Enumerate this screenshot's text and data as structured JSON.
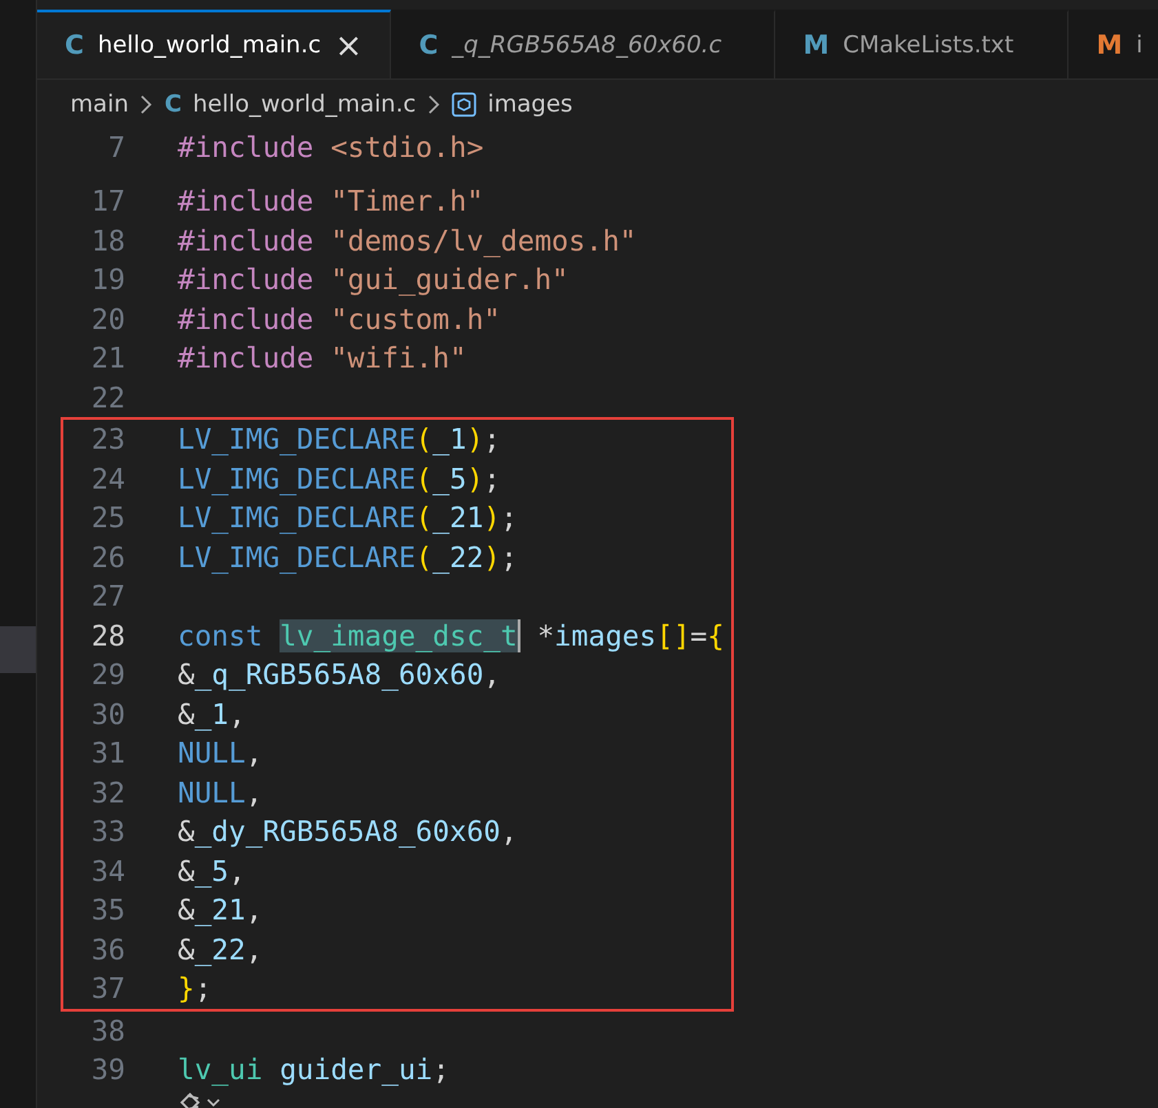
{
  "tabs": [
    {
      "icon": "C",
      "color": "#519aba",
      "label": "hello_world_main.c",
      "selected": true,
      "preview": false,
      "close": "×"
    },
    {
      "icon": "C",
      "color": "#519aba",
      "label": "_q_RGB565A8_60x60.c",
      "selected": false,
      "preview": true
    },
    {
      "icon": "M",
      "color": "#519aba",
      "label": "CMakeLists.txt",
      "selected": false,
      "preview": false
    },
    {
      "icon": "M",
      "color": "#e37933",
      "label": "i",
      "selected": false,
      "preview": false
    }
  ],
  "breadcrumb": [
    {
      "kind": "folder",
      "label": "main"
    },
    {
      "kind": "file",
      "icon": "C",
      "label": "hello_world_main.c"
    },
    {
      "kind": "symbol",
      "label": "images"
    }
  ],
  "sticky_line": {
    "number": "7",
    "tokens": [
      {
        "text": "#include ",
        "kind": "directive"
      },
      {
        "text": "<stdio.h>",
        "kind": "string"
      }
    ]
  },
  "lines_before": [
    {
      "number": "17",
      "current": false,
      "tokens": [
        {
          "text": "#include ",
          "kind": "directive"
        },
        {
          "text": "\"Timer.h\"",
          "kind": "string"
        }
      ]
    },
    {
      "number": "18",
      "current": false,
      "tokens": [
        {
          "text": "#include ",
          "kind": "directive"
        },
        {
          "text": "\"demos/lv_demos.h\"",
          "kind": "string"
        }
      ]
    },
    {
      "number": "19",
      "current": false,
      "tokens": [
        {
          "text": "#include ",
          "kind": "directive"
        },
        {
          "text": "\"gui_guider.h\"",
          "kind": "string"
        }
      ]
    },
    {
      "number": "20",
      "current": false,
      "tokens": [
        {
          "text": "#include ",
          "kind": "directive"
        },
        {
          "text": "\"custom.h\"",
          "kind": "string"
        }
      ]
    },
    {
      "number": "21",
      "current": false,
      "tokens": [
        {
          "text": "#include ",
          "kind": "directive"
        },
        {
          "text": "\"wifi.h\"",
          "kind": "string"
        }
      ]
    },
    {
      "number": "22",
      "current": false
    }
  ],
  "boxed_lines": [
    {
      "number": "23",
      "current": false,
      "tokens": [
        {
          "text": "LV_IMG_DECLARE",
          "kind": "macro"
        },
        {
          "text": "(",
          "kind": "bracket"
        },
        {
          "text": "_1",
          "kind": "var"
        },
        {
          "text": ")",
          "kind": "bracket"
        },
        {
          "text": ";",
          "kind": "punct"
        }
      ]
    },
    {
      "number": "24",
      "current": false,
      "tokens": [
        {
          "text": "LV_IMG_DECLARE",
          "kind": "macro"
        },
        {
          "text": "(",
          "kind": "bracket"
        },
        {
          "text": "_5",
          "kind": "var"
        },
        {
          "text": ")",
          "kind": "bracket"
        },
        {
          "text": ";",
          "kind": "punct"
        }
      ]
    },
    {
      "number": "25",
      "current": false,
      "tokens": [
        {
          "text": "LV_IMG_DECLARE",
          "kind": "macro"
        },
        {
          "text": "(",
          "kind": "bracket"
        },
        {
          "text": "_21",
          "kind": "var"
        },
        {
          "text": ")",
          "kind": "bracket"
        },
        {
          "text": ";",
          "kind": "punct"
        }
      ]
    },
    {
      "number": "26",
      "current": false,
      "tokens": [
        {
          "text": "LV_IMG_DECLARE",
          "kind": "macro"
        },
        {
          "text": "(",
          "kind": "bracket"
        },
        {
          "text": "_22",
          "kind": "var"
        },
        {
          "text": ")",
          "kind": "bracket"
        },
        {
          "text": ";",
          "kind": "punct"
        }
      ]
    },
    {
      "number": "27",
      "current": false
    },
    {
      "number": "28",
      "current": true,
      "tokens": [
        {
          "text": "const ",
          "kind": "keyword",
          "highlighted": false
        },
        {
          "text": "lv_image_dsc_t",
          "kind": "type",
          "highlighted": true
        },
        {
          "text": " *",
          "kind": "punct",
          "highlighted": false
        },
        {
          "text": "images",
          "kind": "var",
          "highlighted": false
        },
        {
          "text": "[]",
          "kind": "bracket",
          "highlighted": false
        },
        {
          "text": "=",
          "kind": "punct",
          "highlighted": false
        },
        {
          "text": "{",
          "kind": "bracket",
          "highlighted": false
        }
      ]
    },
    {
      "number": "29",
      "current": false,
      "tokens": [
        {
          "text": "&",
          "kind": "punct"
        },
        {
          "text": "_q_RGB565A8_60x60",
          "kind": "var"
        },
        {
          "text": ",",
          "kind": "punct"
        }
      ]
    },
    {
      "number": "30",
      "current": false,
      "tokens": [
        {
          "text": "&",
          "kind": "punct"
        },
        {
          "text": "_1",
          "kind": "var"
        },
        {
          "text": ",",
          "kind": "punct"
        }
      ]
    },
    {
      "number": "31",
      "current": false,
      "tokens": [
        {
          "text": "NULL",
          "kind": "keyword"
        },
        {
          "text": ",",
          "kind": "punct"
        }
      ]
    },
    {
      "number": "32",
      "current": false,
      "tokens": [
        {
          "text": "NULL",
          "kind": "keyword"
        },
        {
          "text": ",",
          "kind": "punct"
        }
      ]
    },
    {
      "number": "33",
      "current": false,
      "tokens": [
        {
          "text": "&",
          "kind": "punct"
        },
        {
          "text": "_dy_RGB565A8_60x60",
          "kind": "var"
        },
        {
          "text": ",",
          "kind": "punct"
        }
      ]
    },
    {
      "number": "34",
      "current": false,
      "tokens": [
        {
          "text": "&",
          "kind": "punct"
        },
        {
          "text": "_5",
          "kind": "var"
        },
        {
          "text": ",",
          "kind": "punct"
        }
      ]
    },
    {
      "number": "35",
      "current": false,
      "tokens": [
        {
          "text": "&",
          "kind": "punct"
        },
        {
          "text": "_21",
          "kind": "var"
        },
        {
          "text": ",",
          "kind": "punct"
        }
      ]
    },
    {
      "number": "36",
      "current": false,
      "tokens": [
        {
          "text": "&",
          "kind": "punct"
        },
        {
          "text": "_22",
          "kind": "var"
        },
        {
          "text": ",",
          "kind": "punct"
        }
      ]
    },
    {
      "number": "37",
      "current": false,
      "tokens": [
        {
          "text": "}",
          "kind": "bracket"
        },
        {
          "text": ";",
          "kind": "punct"
        }
      ]
    }
  ],
  "lines_after": [
    {
      "number": "38",
      "current": false
    },
    {
      "number": "39",
      "current": false,
      "tokens": [
        {
          "text": "lv_ui ",
          "kind": "type"
        },
        {
          "text": "guider_ui",
          "kind": "var"
        },
        {
          "text": ";",
          "kind": "punct"
        }
      ]
    }
  ]
}
